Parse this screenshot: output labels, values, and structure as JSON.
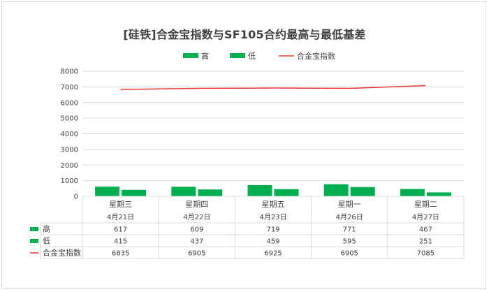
{
  "chart_data": {
    "type": "bar",
    "title": "[硅铁]合金宝指数与SF105合约最高与最低基差",
    "categories": [
      {
        "weekday": "星期三",
        "date": "4月21日"
      },
      {
        "weekday": "星期四",
        "date": "4月22日"
      },
      {
        "weekday": "星期五",
        "date": "4月23日"
      },
      {
        "weekday": "星期一",
        "date": "4月26日"
      },
      {
        "weekday": "星期二",
        "date": "4月27日"
      }
    ],
    "series": [
      {
        "name": "高",
        "kind": "bar",
        "color": "#00b050",
        "values": [
          617,
          609,
          719,
          771,
          467
        ]
      },
      {
        "name": "低",
        "kind": "bar",
        "color": "#00b050",
        "values": [
          415,
          437,
          459,
          595,
          251
        ]
      },
      {
        "name": "合金宝指数",
        "kind": "line",
        "color": "#e8382f",
        "values": [
          6835,
          6905,
          6925,
          6905,
          7085
        ]
      }
    ],
    "ylim": [
      0,
      8000
    ],
    "yticks": [
      "0",
      "1000",
      "2000",
      "3000",
      "4000",
      "5000",
      "6000",
      "7000",
      "8000"
    ],
    "grid": true,
    "legend": "top",
    "data_table": true
  }
}
